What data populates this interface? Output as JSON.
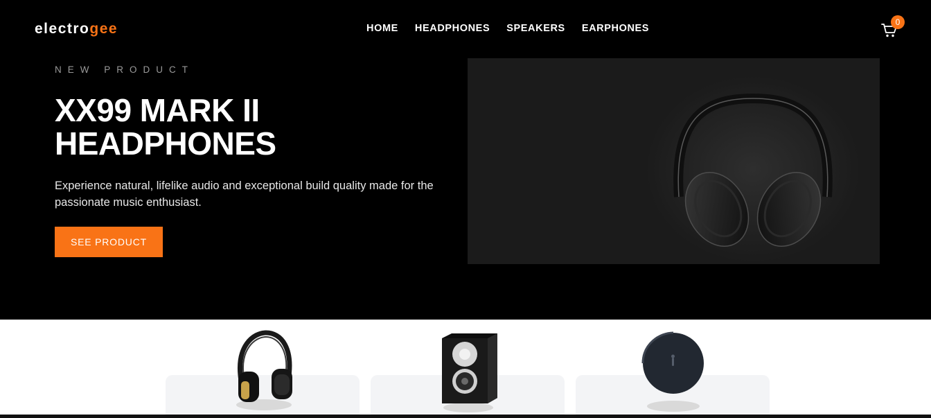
{
  "header": {
    "logo_prefix": "electro",
    "logo_accent": "gee",
    "nav": [
      "HOME",
      "HEADPHONES",
      "SPEAKERS",
      "EARPHONES"
    ],
    "cart_count": "0",
    "cart_icon": "shopping-cart-icon"
  },
  "hero": {
    "eyebrow": "NEW PRODUCT",
    "title": "XX99 MARK II HEADPHONES",
    "description": "Experience natural, lifelike audio and exceptional build quality made for the passionate music enthusiast.",
    "cta_label": "SEE PRODUCT",
    "image_icon": "headphones-image"
  },
  "categories": [
    {
      "image_icon": "headphones-image"
    },
    {
      "image_icon": "speaker-image"
    },
    {
      "image_icon": "earbuds-case-image"
    }
  ],
  "colors": {
    "accent": "#f97316",
    "hero_bg": "#000000",
    "card_bg": "#f3f4f6"
  }
}
